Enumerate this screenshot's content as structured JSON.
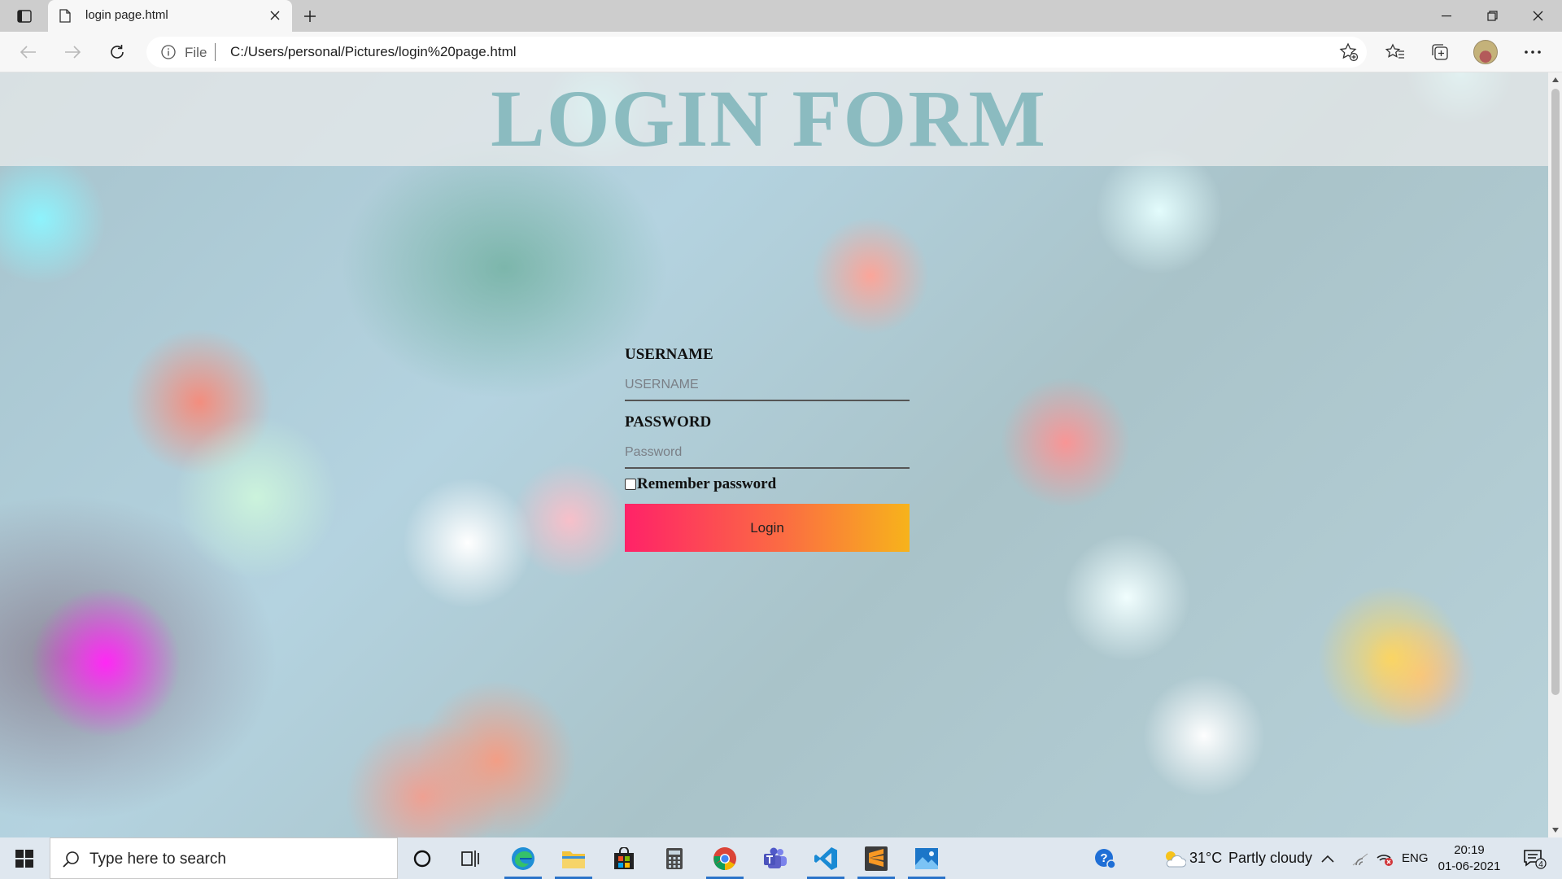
{
  "browser": {
    "tab_title": "login page.html",
    "address_scheme": "File",
    "url": "C:/Users/personal/Pictures/login%20page.html"
  },
  "page": {
    "title": "LOGIN FORM",
    "username_label": "USERNAME",
    "username_placeholder": "USERNAME",
    "password_label": "PASSWORD",
    "password_placeholder": "Password",
    "remember_label": "Remember password",
    "remember_checked": false,
    "login_button": "Login"
  },
  "taskbar": {
    "search_placeholder": "Type here to search",
    "apps": [
      "cortana-icon",
      "task-view-icon",
      "edge-icon",
      "file-explorer-icon",
      "store-icon",
      "calculator-icon",
      "chrome-icon",
      "teams-icon",
      "vscode-icon",
      "sublime-icon",
      "photos-icon"
    ],
    "weather": "31°C",
    "weather_desc": "Partly cloudy",
    "language": "ENG",
    "time": "20:19",
    "date": "01-06-2021",
    "notification_count": "4"
  },
  "colors": {
    "login_gradient_start": "#ff2268",
    "login_gradient_end": "#f7b31b",
    "title_color": "#7db4b9"
  }
}
